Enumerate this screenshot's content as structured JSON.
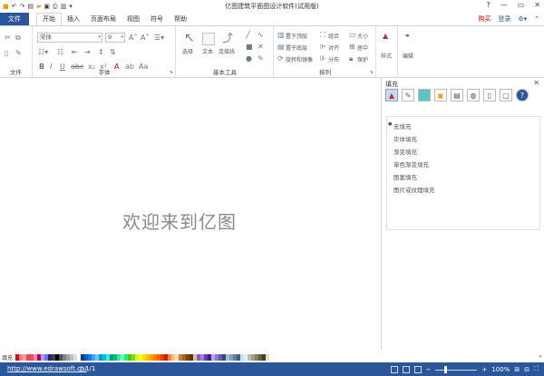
{
  "app": {
    "title": "亿图建筑平面图设计软件(试用版)",
    "window_controls": {
      "help": "?",
      "minimize": "—",
      "maximize": "▭",
      "close": "✕"
    }
  },
  "menu": {
    "file_tab": "文件",
    "tabs": [
      "开始",
      "插入",
      "页面布局",
      "视图",
      "符号",
      "帮助"
    ],
    "active_tab": "开始",
    "buy": "购买",
    "login": "登录"
  },
  "ribbon": {
    "groups": {
      "file": "文件",
      "font": "字体",
      "basic_tools": "基本工具",
      "arrange": "排列"
    },
    "font_name": "宋体",
    "font_size": "9",
    "tools": {
      "select": "选择",
      "text": "文本",
      "connector": "连接线"
    },
    "arrange": {
      "bring_front": "置于顶层",
      "send_back": "置于底层",
      "rotate_flip": "旋转和镜像",
      "group": "组合",
      "align": "对齐",
      "distribute": "分布",
      "size": "大小",
      "center": "居中",
      "protect": "保护"
    },
    "style": "样式",
    "edit": "编辑"
  },
  "fill_panel": {
    "title": "填充",
    "options": [
      "无填充",
      "实体填充",
      "渐变填充",
      "单色渐变填充",
      "图案填充",
      "图片或纹理填充"
    ],
    "selected": "无填充"
  },
  "canvas": {
    "welcome": "欢迎来到亿图"
  },
  "palette": {
    "label": "填充",
    "colors": [
      "#e8001c",
      "#ff7f7f",
      "#f3a0a0",
      "#e05050",
      "#ff4070",
      "#ff90b0",
      "#c00040",
      "#a0a0ff",
      "#7070e0",
      "#202080",
      "#404040",
      "#000000",
      "#505050",
      "#808080",
      "#a0a0a0",
      "#c0c0c0",
      "#e0e0e0",
      "#ffffff",
      "#004080",
      "#0060c0",
      "#0080ff",
      "#40a0ff",
      "#80c0ff",
      "#00a0c0",
      "#00c0e0",
      "#40e0ff",
      "#00a060",
      "#00c080",
      "#40e0a0",
      "#80ffc0",
      "#00ff80",
      "#60c000",
      "#80e000",
      "#c0ff40",
      "#ffff00",
      "#ffe000",
      "#ffc000",
      "#ffa000",
      "#ff8000",
      "#ff6000",
      "#e04000",
      "#c02000",
      "#ff8040",
      "#ffc080",
      "#ffe0c0",
      "#c08040",
      "#a06020",
      "#804000",
      "#603000",
      "#e0c0a0",
      "#8060c0",
      "#a080e0",
      "#6040a0",
      "#402080",
      "#c0a0ff",
      "#8080c0",
      "#6060a0",
      "#404080",
      "#a0c0e0",
      "#80a0c0",
      "#6080a0",
      "#406080",
      "#c0e0ff",
      "#e0f0ff",
      "#c0c0a0",
      "#a0a080",
      "#808060",
      "#606040",
      "#404020",
      "#e0e0c0"
    ],
    "end": "»"
  },
  "status": {
    "url": "http://www.edrawsoft.cn/",
    "page": "1/1",
    "zoom": "100%",
    "zoom_value": 100
  }
}
